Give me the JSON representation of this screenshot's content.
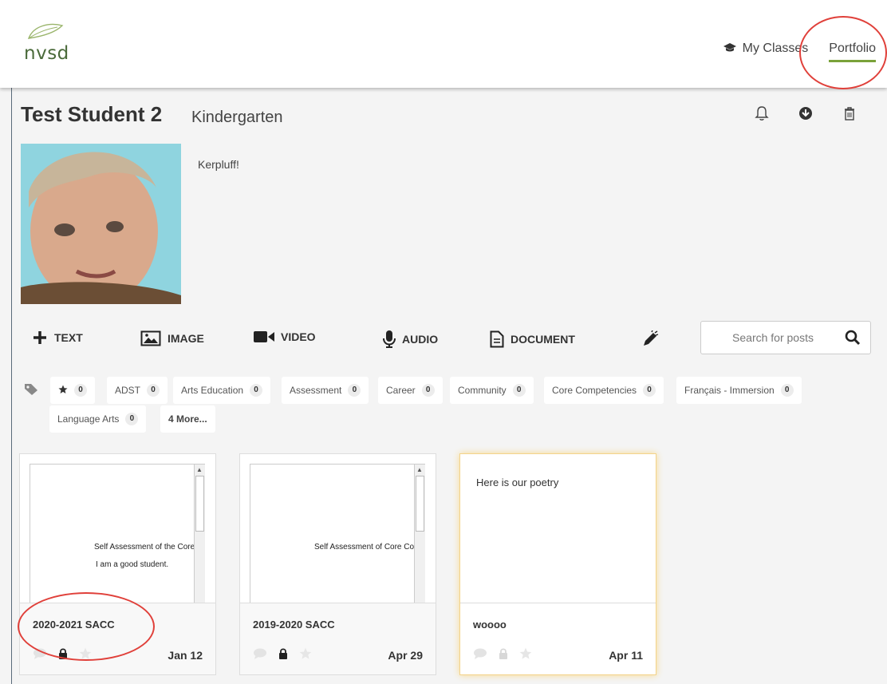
{
  "brand": {
    "logo_text": "nvsd",
    "accent": "#7aa23a"
  },
  "nav": {
    "my_classes": "My Classes",
    "portfolio": "Portfolio"
  },
  "student": {
    "name": "Test Student 2",
    "grade": "Kindergarten",
    "bio": "Kerpluff!"
  },
  "actions": {
    "icons": [
      "bell-icon",
      "download-icon",
      "trash-icon"
    ]
  },
  "toolbar": {
    "text": "TEXT",
    "image": "IMAGE",
    "video": "VIDEO",
    "audio": "AUDIO",
    "document": "DOCUMENT",
    "search_placeholder": "Search for posts"
  },
  "tags": {
    "starred": {
      "count": "0"
    },
    "items": [
      {
        "label": "ADST",
        "count": "0"
      },
      {
        "label": "Arts Education",
        "count": "0"
      },
      {
        "label": "Assessment",
        "count": "0"
      },
      {
        "label": "Career",
        "count": "0"
      },
      {
        "label": "Community",
        "count": "0"
      },
      {
        "label": "Core Competencies",
        "count": "0"
      },
      {
        "label": "Français - Immersion",
        "count": "0"
      },
      {
        "label": "Language Arts",
        "count": "0"
      }
    ],
    "more": "4 More..."
  },
  "posts": [
    {
      "title": "2020-2021 SACC",
      "date": "Jan 12",
      "preview_lines": [
        "Self Assessment of the Core",
        "I am a good student."
      ]
    },
    {
      "title": "2019-2020 SACC",
      "date": "Apr 29",
      "preview_lines": [
        "Self Assessment of Core Co"
      ]
    },
    {
      "title": "woooo",
      "date": "Apr 11",
      "text": "Here is our poetry"
    }
  ]
}
